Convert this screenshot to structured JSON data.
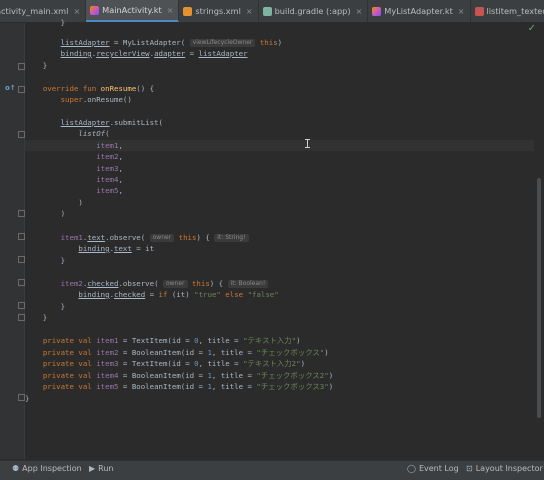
{
  "tabs": [
    {
      "label": "activity_main.xml",
      "icon": "xml-file-icon"
    },
    {
      "label": "MainActivity.kt",
      "icon": "kotlin-file-icon",
      "active": true
    },
    {
      "label": "strings.xml",
      "icon": "xml-file-icon"
    },
    {
      "label": "build.gradle (:app)",
      "icon": "gradle-file-icon"
    },
    {
      "label": "MyListAdapter.kt",
      "icon": "kotlin-file-icon"
    },
    {
      "label": "listitem_textedit.xml",
      "icon": "layout-file-icon"
    }
  ],
  "close_glyph": "×",
  "hints": {
    "view_lifecycle_owner": "viewLifecycleOwner",
    "owner": "owner",
    "it_string": "it: String!",
    "it_boolean": "it: Boolean!"
  },
  "status": {
    "app_inspection": "App Inspection",
    "run": "Run",
    "event_log": "Event Log",
    "layout_inspector": "Layout Inspector"
  }
}
